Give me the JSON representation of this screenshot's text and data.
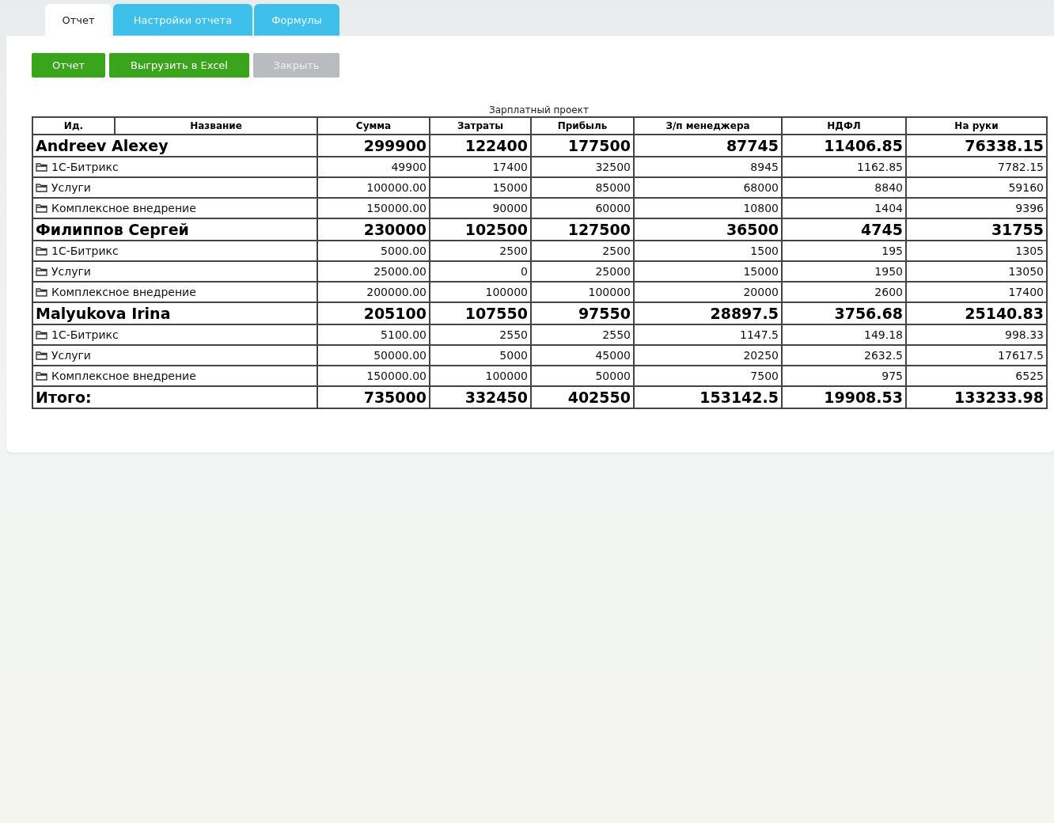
{
  "tabs": [
    {
      "label": "Отчет",
      "selected": true
    },
    {
      "label": "Настройки отчета",
      "selected": false
    },
    {
      "label": "Формулы",
      "selected": false
    }
  ],
  "buttons": [
    {
      "label": "Отчет",
      "disabled": false
    },
    {
      "label": "Выгрузить в Excel",
      "disabled": false
    },
    {
      "label": "Закрыть",
      "disabled": true
    }
  ],
  "table": {
    "caption": "Зарплатный проект",
    "columns": [
      "Ид.",
      "Название",
      "Сумма",
      "Затраты",
      "Прибыль",
      "З/п менеджера",
      "НДФЛ",
      "На руки"
    ],
    "rows": [
      {
        "kind": "group",
        "name": "Andreev Alexey",
        "values": [
          "299900",
          "122400",
          "177500",
          "87745",
          "11406.85",
          "76338.15"
        ]
      },
      {
        "kind": "item",
        "name": "1С-Битрикс",
        "values": [
          "49900",
          "17400",
          "32500",
          "8945",
          "1162.85",
          "7782.15"
        ]
      },
      {
        "kind": "item",
        "name": "Услуги",
        "values": [
          "100000.00",
          "15000",
          "85000",
          "68000",
          "8840",
          "59160"
        ]
      },
      {
        "kind": "item",
        "name": "Комплексное внедрение",
        "values": [
          "150000.00",
          "90000",
          "60000",
          "10800",
          "1404",
          "9396"
        ]
      },
      {
        "kind": "group",
        "name": "Филиппов Сергей",
        "values": [
          "230000",
          "102500",
          "127500",
          "36500",
          "4745",
          "31755"
        ]
      },
      {
        "kind": "item",
        "name": "1С-Битрикс",
        "values": [
          "5000.00",
          "2500",
          "2500",
          "1500",
          "195",
          "1305"
        ]
      },
      {
        "kind": "item",
        "name": "Услуги",
        "values": [
          "25000.00",
          "0",
          "25000",
          "15000",
          "1950",
          "13050"
        ]
      },
      {
        "kind": "item",
        "name": "Комплексное внедрение",
        "values": [
          "200000.00",
          "100000",
          "100000",
          "20000",
          "2600",
          "17400"
        ]
      },
      {
        "kind": "group",
        "name": "Malyukova Irina",
        "values": [
          "205100",
          "107550",
          "97550",
          "28897.5",
          "3756.68",
          "25140.83"
        ]
      },
      {
        "kind": "item",
        "name": "1С-Битрикс",
        "values": [
          "5100.00",
          "2550",
          "2550",
          "1147.5",
          "149.18",
          "998.33"
        ]
      },
      {
        "kind": "item",
        "name": "Услуги",
        "values": [
          "50000.00",
          "5000",
          "45000",
          "20250",
          "2632.5",
          "17617.5"
        ]
      },
      {
        "kind": "item",
        "name": "Комплексное внедрение",
        "values": [
          "150000.00",
          "100000",
          "50000",
          "7500",
          "975",
          "6525"
        ]
      },
      {
        "kind": "total",
        "name": "Итого:",
        "values": [
          "735000",
          "332450",
          "402550",
          "153142.5",
          "19908.53",
          "133233.98"
        ]
      }
    ]
  }
}
